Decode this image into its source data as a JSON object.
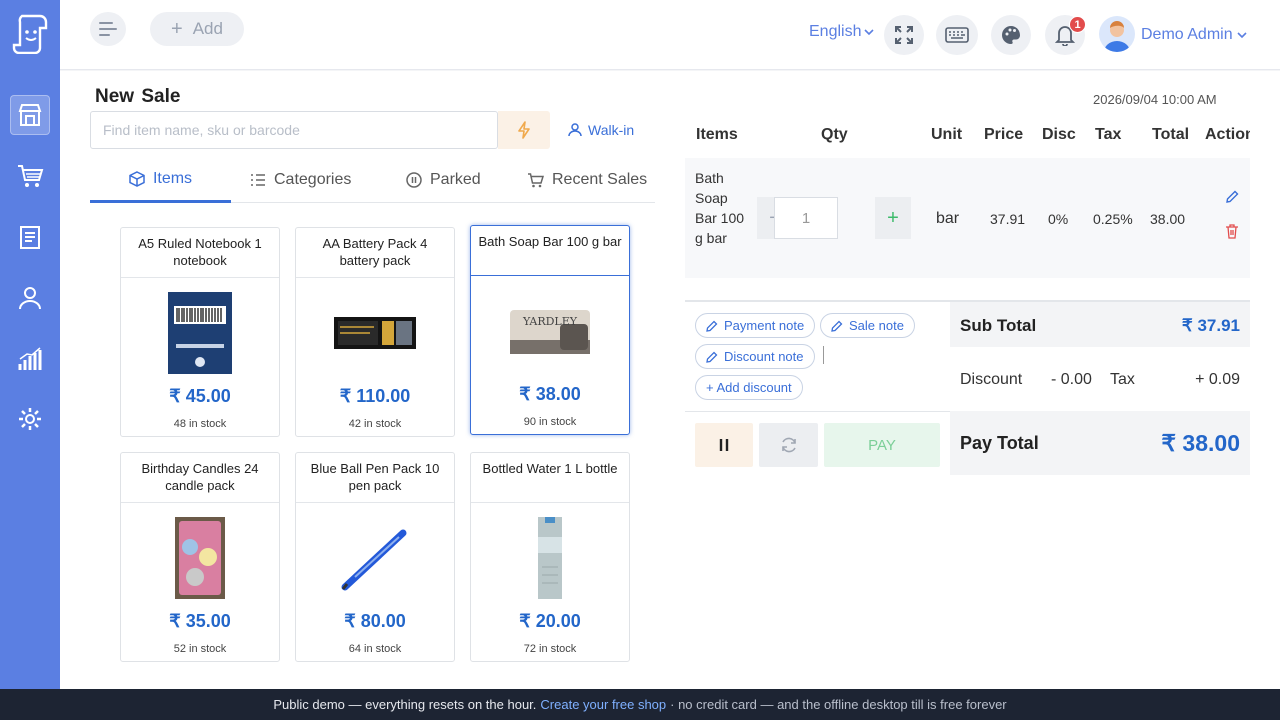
{
  "sidebar": {
    "items": [
      {
        "icon": "store-icon",
        "active": true
      },
      {
        "icon": "cart-icon",
        "active": false
      },
      {
        "icon": "clipboard-icon",
        "active": false
      },
      {
        "icon": "user-icon",
        "active": false
      },
      {
        "icon": "chart-icon",
        "active": false
      },
      {
        "icon": "gear-icon",
        "active": false
      }
    ]
  },
  "topbar": {
    "add_label": "Add",
    "language": "English",
    "notification_count": "1",
    "user_name": "Demo Admin"
  },
  "sale": {
    "title": "New  Sale",
    "date": "2026/09/04 10:00 AM",
    "search_placeholder": "Find item name, sku or barcode",
    "customer": "Walk-in"
  },
  "tabs": [
    {
      "label": "Items",
      "active": true
    },
    {
      "label": "Categories",
      "active": false
    },
    {
      "label": "Parked",
      "active": false
    },
    {
      "label": "Recent Sales",
      "active": false
    }
  ],
  "products": [
    {
      "name": "A5 Ruled Notebook 1 notebook",
      "price": "₹ 45.00",
      "stock": "48 in stock"
    },
    {
      "name": "AA Battery Pack 4 battery pack",
      "price": "₹ 110.00",
      "stock": "42 in stock"
    },
    {
      "name": "Bath Soap Bar 100 g bar",
      "price": "₹ 38.00",
      "stock": "90 in stock",
      "selected": true
    },
    {
      "name": "Birthday Candles 24 candle pack",
      "price": "₹ 35.00",
      "stock": "52 in stock"
    },
    {
      "name": "Blue Ball Pen Pack 10 pen pack",
      "price": "₹ 80.00",
      "stock": "64 in stock"
    },
    {
      "name": "Bottled Water 1 L bottle",
      "price": "₹ 20.00",
      "stock": "72 in stock"
    }
  ],
  "cart": {
    "headers": {
      "items": "Items",
      "qty": "Qty",
      "unit": "Unit",
      "price": "Price",
      "disc": "Disc",
      "tax": "Tax",
      "total": "Total",
      "action": "Action"
    },
    "rows": [
      {
        "name": "Bath Soap Bar 100 g bar",
        "qty": "1",
        "unit": "bar",
        "price": "37.91",
        "disc": "0%",
        "tax": "0.25%",
        "total": "38.00"
      }
    ]
  },
  "notes": {
    "payment_note": "Payment note",
    "sale_note": "Sale note",
    "discount_note": "Discount note",
    "add_discount": "+ Add discount"
  },
  "totals": {
    "sub_total_label": "Sub Total",
    "sub_total_value": "₹ 37.91",
    "discount_label": "Discount",
    "discount_value": "- 0.00",
    "tax_label": "Tax",
    "tax_value": "+ 0.09",
    "pay_total_label": "Pay Total",
    "pay_total_value": "₹ 38.00"
  },
  "actions": {
    "pay_label": "PAY"
  },
  "footer": {
    "text": "Public demo — everything resets on the hour.",
    "link": "Create your free shop",
    "tail": "· no credit card — and the offline desktop till is free forever"
  },
  "colors": {
    "brand": "#5b7fe2",
    "price_blue": "#2366c9",
    "pay_green": "#7ccf98",
    "badge_red": "#e24c4c"
  }
}
